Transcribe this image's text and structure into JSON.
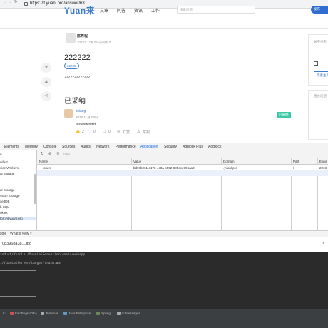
{
  "browser": {
    "url": "https://it.yuanl.pro/answer/63"
  },
  "site": {
    "logo": "Yuan来",
    "nav": [
      "文章",
      "问答",
      "资讯",
      "工作"
    ],
    "search_placeholder": "搜索问题",
    "ask_button": "发布 +"
  },
  "question": {
    "author": "陈秀程",
    "meta": "2018年11月28日  阅读 0",
    "title": "222222",
    "tag": "22222",
    "body": "2222222222222"
  },
  "answer": {
    "section_title": "已采纳",
    "user": "lixiang",
    "meta": "2018-11月 09日",
    "badge": "已采纳",
    "body": "testesttesttst",
    "likes": "2",
    "comments": "0",
    "replies": "0",
    "reward": "打赏",
    "report": "举报"
  },
  "right_panel": {
    "card1_title": "关于作者",
    "card1_btn": "作者主页",
    "card2_title": "相关问题"
  },
  "devtools": {
    "tabs": [
      "Elements",
      "Memory",
      "Console",
      "Sources",
      "Audits",
      "Network",
      "Performance",
      "Application",
      "Security",
      "Adblock Plus",
      "AdBlock"
    ],
    "active_tab": "Application",
    "filter_placeholder": "Filter",
    "sidebar": [
      "n",
      "nifest",
      "vice Workers",
      "ar storage",
      "al Storage",
      "ssion Storage",
      "xedDB",
      "b SQL",
      "okies",
      "tps://it.yuanl.pro"
    ],
    "columns": [
      "Name",
      "Value",
      "Domain",
      "Path",
      "Expir"
    ],
    "rows": [
      {
        "name": "token",
        "value": "bd07b061-a172-4c0a-b592-085ece996aa0",
        "domain": ".yuanl.pro",
        "path": "/",
        "expires": "2018"
      }
    ]
  },
  "drawer": {
    "tabs": [
      "sole",
      "What's New ×"
    ],
    "file": "70b3968a38....jpg",
    "close": "×"
  },
  "terminal": {
    "lines": [
      "roduct/YuanLai/YuanLaiServer/src/main/webapp]",
      "i/YuanLaiServer/target/train.war"
    ]
  },
  "ide_bar": {
    "items": [
      "6:",
      "FindBugs-IDEA",
      "Terminal",
      "Java Enterprise",
      "Spring",
      "0: Messages"
    ]
  }
}
